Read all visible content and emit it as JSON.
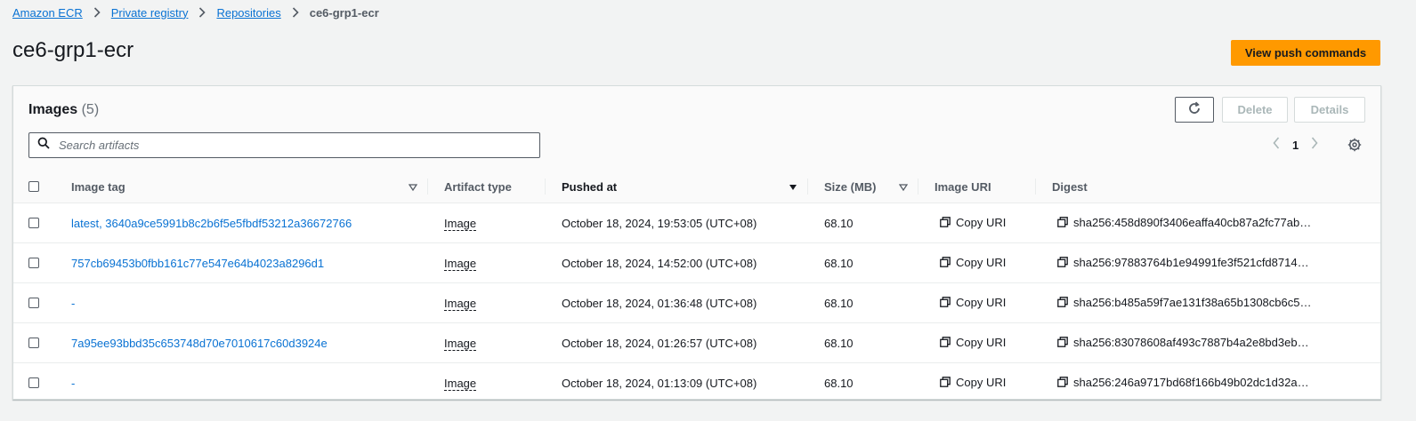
{
  "breadcrumb": {
    "items": [
      "Amazon ECR",
      "Private registry",
      "Repositories"
    ],
    "current": "ce6-grp1-ecr"
  },
  "page": {
    "title": "ce6-grp1-ecr",
    "push_button": "View push commands"
  },
  "images": {
    "title": "Images",
    "count": "(5)",
    "delete_label": "Delete",
    "details_label": "Details",
    "search_placeholder": "Search artifacts",
    "page_number": "1",
    "columns": [
      "Image tag",
      "Artifact type",
      "Pushed at",
      "Size (MB)",
      "Image URI",
      "Digest"
    ],
    "copy_label": "Copy URI",
    "rows": [
      {
        "tag": "latest, 3640a9ce5991b8c2b6f5e5fbdf53212a36672766",
        "type": "Image",
        "pushed": "October 18, 2024, 19:53:05 (UTC+08)",
        "size": "68.10",
        "digest": "sha256:458d890f3406eaffa40cb87a2fc77ab…"
      },
      {
        "tag": "757cb69453b0fbb161c77e547e64b4023a8296d1",
        "type": "Image",
        "pushed": "October 18, 2024, 14:52:00 (UTC+08)",
        "size": "68.10",
        "digest": "sha256:97883764b1e94991fe3f521cfd8714…"
      },
      {
        "tag": "-",
        "type": "Image",
        "pushed": "October 18, 2024, 01:36:48 (UTC+08)",
        "size": "68.10",
        "digest": "sha256:b485a59f7ae131f38a65b1308cb6c5…"
      },
      {
        "tag": "7a95ee93bbd35c653748d70e7010617c60d3924e",
        "type": "Image",
        "pushed": "October 18, 2024, 01:26:57 (UTC+08)",
        "size": "68.10",
        "digest": "sha256:83078608af493c7887b4a2e8bd3eb…"
      },
      {
        "tag": "-",
        "type": "Image",
        "pushed": "October 18, 2024, 01:13:09 (UTC+08)",
        "size": "68.10",
        "digest": "sha256:246a9717bd68f166b49b02dc1d32a…"
      }
    ]
  },
  "colors": {
    "accent": "#ff9900",
    "link": "#0972d3",
    "text": "#16191f",
    "background": "#f2f3f3"
  }
}
